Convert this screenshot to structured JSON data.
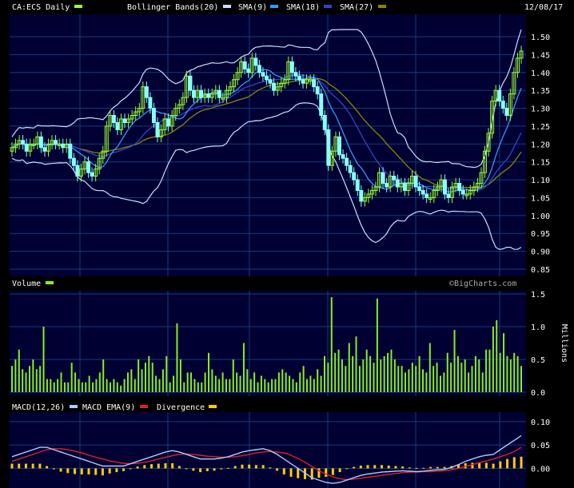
{
  "header": {
    "symbol_label": "CA:ECS Daily",
    "bollinger_label": "Bollinger Bands(20)",
    "sma9_label": "SMA(9)",
    "sma18_label": "SMA(18)",
    "sma27_label": "SMA(27)",
    "date": "12/08/17"
  },
  "volume_label": "Volume",
  "watermark": "©BigCharts.com",
  "macd_labels": {
    "macd": "MACD(12,26)",
    "ema": "MACD EMA(9)",
    "div": "Divergence"
  },
  "colors": {
    "panel_bg": "#000033",
    "grid": "#1a3a7a",
    "price_up": "#99ff33",
    "price_down": "#88ffff",
    "bollinger": "#ccddff",
    "sma9": "#3399ff",
    "sma18": "#3344cc",
    "sma27": "#888800",
    "volume": "#88ee22",
    "macd": "#aaccff",
    "macd_ema": "#dd2222",
    "divergence": "#ffcc00"
  },
  "chart_data": [
    {
      "type": "candlestick",
      "title": "CA:ECS Daily",
      "ylim": [
        0.85,
        1.5
      ],
      "yticks": [
        "0.85",
        "0.90",
        "0.95",
        "1.00",
        "1.05",
        "1.10",
        "1.15",
        "1.20",
        "1.25",
        "1.30",
        "1.35",
        "1.40",
        "1.45",
        "1.50"
      ],
      "close": [
        1.19,
        1.2,
        1.21,
        1.2,
        1.18,
        1.2,
        1.2,
        1.22,
        1.19,
        1.18,
        1.2,
        1.21,
        1.2,
        1.2,
        1.19,
        1.2,
        1.16,
        1.14,
        1.11,
        1.13,
        1.15,
        1.12,
        1.11,
        1.13,
        1.16,
        1.18,
        1.25,
        1.28,
        1.26,
        1.24,
        1.27,
        1.26,
        1.27,
        1.28,
        1.29,
        1.3,
        1.36,
        1.33,
        1.3,
        1.26,
        1.22,
        1.24,
        1.27,
        1.25,
        1.28,
        1.3,
        1.31,
        1.33,
        1.39,
        1.35,
        1.33,
        1.35,
        1.33,
        1.34,
        1.33,
        1.34,
        1.35,
        1.33,
        1.33,
        1.35,
        1.36,
        1.38,
        1.4,
        1.43,
        1.41,
        1.4,
        1.44,
        1.42,
        1.4,
        1.39,
        1.38,
        1.37,
        1.35,
        1.36,
        1.37,
        1.38,
        1.43,
        1.4,
        1.39,
        1.38,
        1.37,
        1.38,
        1.38,
        1.36,
        1.34,
        1.28,
        1.24,
        1.14,
        1.18,
        1.22,
        1.17,
        1.16,
        1.14,
        1.12,
        1.1,
        1.07,
        1.04,
        1.05,
        1.06,
        1.07,
        1.08,
        1.12,
        1.09,
        1.08,
        1.11,
        1.1,
        1.08,
        1.09,
        1.07,
        1.09,
        1.11,
        1.08,
        1.07,
        1.06,
        1.05,
        1.05,
        1.07,
        1.08,
        1.1,
        1.06,
        1.05,
        1.08,
        1.09,
        1.07,
        1.06,
        1.06,
        1.07,
        1.08,
        1.09,
        1.12,
        1.18,
        1.23,
        1.32,
        1.35,
        1.32,
        1.3,
        1.28,
        1.34,
        1.4,
        1.44,
        1.46
      ],
      "yaxis_side": "right"
    },
    {
      "type": "bar",
      "title": "Volume",
      "ylim": [
        0,
        1.5
      ],
      "yticks": [
        "0.0",
        "0.5",
        "1.0",
        "1.5"
      ],
      "ylabel": "Millions",
      "values": [
        0.4,
        0.5,
        0.65,
        0.35,
        0.3,
        0.4,
        0.5,
        0.35,
        0.4,
        1.0,
        0.2,
        0.2,
        0.15,
        0.2,
        0.3,
        0.15,
        0.15,
        0.45,
        0.3,
        0.2,
        0.15,
        0.15,
        0.25,
        0.15,
        0.2,
        0.3,
        0.5,
        0.2,
        0.15,
        0.2,
        0.15,
        0.1,
        0.2,
        0.3,
        0.35,
        0.2,
        0.5,
        0.35,
        0.45,
        0.55,
        0.45,
        0.25,
        0.2,
        0.35,
        0.55,
        0.15,
        0.25,
        1.05,
        0.5,
        0.15,
        0.3,
        0.3,
        0.2,
        0.15,
        0.15,
        0.3,
        0.6,
        0.35,
        0.25,
        0.2,
        0.3,
        0.2,
        0.2,
        0.5,
        0.3,
        0.25,
        0.75,
        0.35,
        0.2,
        0.3,
        0.15,
        0.25,
        0.2,
        0.15,
        0.2,
        0.2,
        0.3,
        0.35,
        0.3,
        0.25,
        0.2,
        0.15,
        0.3,
        0.4,
        0.2,
        0.25,
        0.2,
        0.35,
        0.25,
        0.55,
        0.45,
        1.45,
        0.6,
        0.65,
        0.5,
        0.4,
        0.75,
        0.55,
        0.85,
        0.4,
        0.5,
        0.65,
        0.55,
        0.45,
        1.43,
        0.5,
        0.55,
        0.6,
        0.65,
        0.5,
        0.4,
        0.4,
        0.3,
        0.35,
        0.45,
        0.4,
        0.55,
        0.35,
        0.3,
        0.75,
        0.4,
        0.45,
        0.25,
        0.3,
        0.6,
        0.45,
        0.95,
        0.55,
        0.45,
        0.5,
        0.3,
        0.4,
        0.55,
        0.5,
        0.3,
        0.65,
        0.65,
        1.0,
        1.1,
        0.6,
        0.9,
        0.55,
        0.5,
        0.6,
        0.55,
        0.4
      ],
      "yaxis_side": "right"
    },
    {
      "type": "line",
      "title": "MACD(12,26)",
      "ylim": [
        -0.03,
        0.11
      ],
      "yticks": [
        "0.00",
        "0.05",
        "0.10"
      ],
      "series": [
        {
          "name": "MACD(12,26)",
          "values": [
            0.025,
            0.03,
            0.035,
            0.04,
            0.045,
            0.045,
            0.04,
            0.035,
            0.03,
            0.025,
            0.02,
            0.015,
            0.01,
            0.005,
            0.005,
            0.005,
            0.005,
            0.01,
            0.015,
            0.02,
            0.025,
            0.03,
            0.035,
            0.038,
            0.035,
            0.03,
            0.025,
            0.02,
            0.02,
            0.02,
            0.022,
            0.025,
            0.03,
            0.035,
            0.038,
            0.04,
            0.042,
            0.038,
            0.03,
            0.02,
            0.01,
            0.0,
            -0.01,
            -0.02,
            -0.025,
            -0.03,
            -0.032,
            -0.03,
            -0.025,
            -0.02,
            -0.015,
            -0.012,
            -0.01,
            -0.008,
            -0.007,
            -0.006,
            -0.005,
            -0.006,
            -0.007,
            -0.006,
            -0.004,
            -0.003,
            -0.002,
            0.002,
            0.008,
            0.015,
            0.02,
            0.025,
            0.028,
            0.03,
            0.04,
            0.05,
            0.06,
            0.07
          ]
        },
        {
          "name": "MACD EMA(9)",
          "values": [
            0.015,
            0.02,
            0.025,
            0.03,
            0.035,
            0.04,
            0.042,
            0.042,
            0.04,
            0.037,
            0.033,
            0.028,
            0.024,
            0.02,
            0.016,
            0.013,
            0.011,
            0.01,
            0.011,
            0.013,
            0.016,
            0.02,
            0.024,
            0.027,
            0.03,
            0.031,
            0.03,
            0.028,
            0.026,
            0.025,
            0.024,
            0.024,
            0.025,
            0.027,
            0.03,
            0.033,
            0.035,
            0.036,
            0.035,
            0.033,
            0.028,
            0.021,
            0.013,
            0.004,
            -0.005,
            -0.012,
            -0.018,
            -0.022,
            -0.024,
            -0.023,
            -0.021,
            -0.019,
            -0.017,
            -0.015,
            -0.013,
            -0.011,
            -0.009,
            -0.008,
            -0.008,
            -0.007,
            -0.007,
            -0.006,
            -0.005,
            -0.003,
            0.0,
            0.004,
            0.008,
            0.012,
            0.016,
            0.02,
            0.025,
            0.03,
            0.036,
            0.045
          ]
        },
        {
          "name": "Divergence",
          "values": [
            0.01,
            0.01,
            0.01,
            0.01,
            0.01,
            0.005,
            -0.002,
            -0.007,
            -0.01,
            -0.012,
            -0.013,
            -0.013,
            -0.014,
            -0.015,
            -0.011,
            -0.008,
            -0.006,
            0.0,
            0.004,
            0.007,
            0.009,
            0.01,
            0.011,
            0.011,
            0.005,
            -0.001,
            -0.005,
            -0.008,
            -0.006,
            -0.005,
            -0.002,
            0.001,
            0.005,
            0.008,
            0.008,
            0.007,
            0.007,
            0.002,
            -0.005,
            -0.013,
            -0.018,
            -0.021,
            -0.023,
            -0.024,
            -0.02,
            -0.018,
            -0.014,
            -0.008,
            -0.001,
            0.003,
            0.006,
            0.007,
            0.007,
            0.007,
            0.006,
            0.005,
            0.004,
            0.002,
            0.001,
            0.001,
            0.003,
            0.003,
            0.003,
            0.005,
            0.008,
            0.011,
            0.012,
            0.013,
            0.012,
            0.01,
            0.015,
            0.02,
            0.024,
            0.025
          ]
        }
      ],
      "yaxis_side": "right"
    }
  ]
}
